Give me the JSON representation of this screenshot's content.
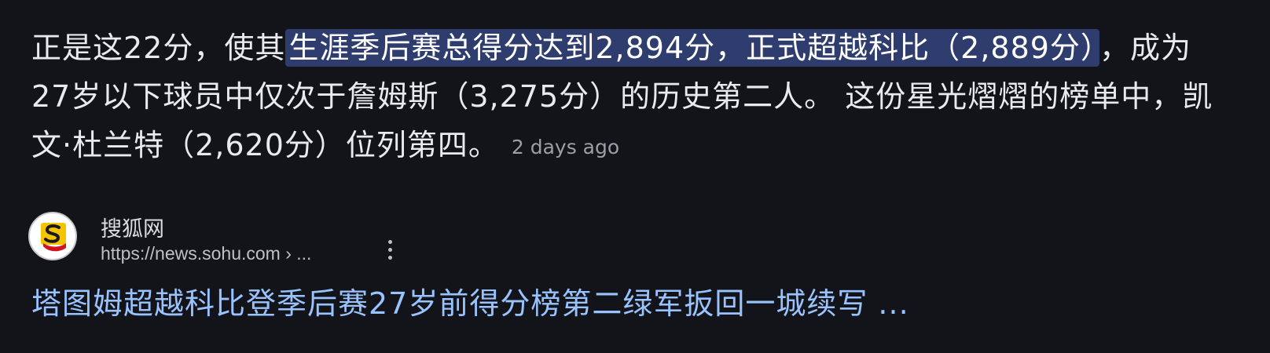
{
  "snippet": {
    "text_before": "正是这22分，使其",
    "highlight": "生涯季后赛总得分达到2,894分，正式超越科比（2,889分）",
    "text_after": "，成为27岁以下球员中仅次于詹姆斯（3,275分）的历史第二人。 这份星光熠熠的榜单中，凯文·杜兰特（2,620分）位列第四。",
    "age": "2 days ago"
  },
  "result": {
    "site_name": "搜狐网",
    "url": "https://news.sohu.com › ...",
    "favicon": "sohu-logo",
    "more_icon": "more-vert-icon",
    "title": "塔图姆超越科比登季后赛27岁前得分榜第二绿军扳回一城续写 ..."
  },
  "colors": {
    "background": "#131419",
    "highlight_bg": "#2e3c6e",
    "link": "#99c3ff",
    "muted": "#9aa0a6"
  }
}
